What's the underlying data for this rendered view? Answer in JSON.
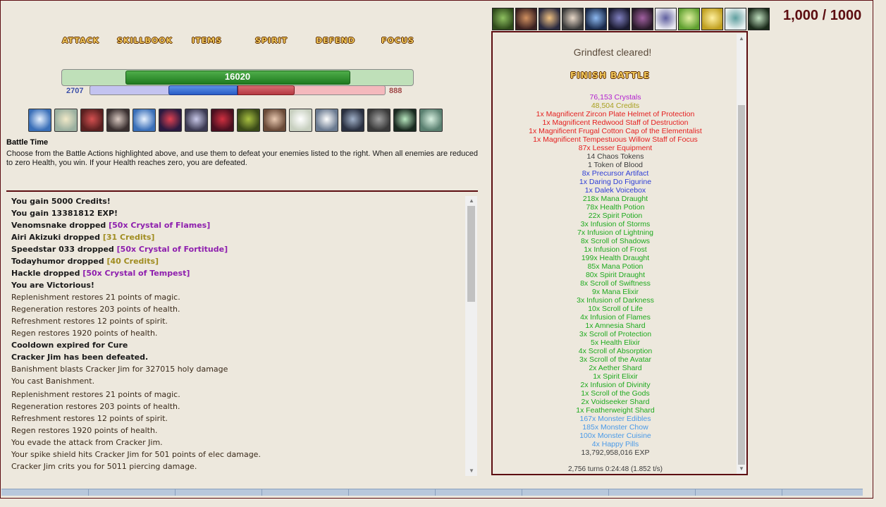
{
  "battle_actions": {
    "attack": "ATTACK",
    "skillbook": "SKILLBOOK",
    "items": "ITEMS",
    "spirit": "SPIRIT",
    "defend": "DEFEND",
    "focus": "FOCUS"
  },
  "player": {
    "health": "16020",
    "health_fill": 0.64,
    "magic": "2707",
    "magic_fill": 0.47,
    "spirit": "888",
    "spirit_fill": 0.39
  },
  "skill_icons": [
    "shield-face-icon",
    "blade-icon",
    "demon-icon",
    "skull-icon",
    "frost-face-icon",
    "fire-icon",
    "wraith-icon",
    "blood-mage-icon",
    "nature-icon",
    "claw-icon",
    "mist-icon",
    "ghost-icon",
    "hooded-icon",
    "monk-icon",
    "cross-icon",
    "wing-icon"
  ],
  "battle_time": {
    "title": "Battle Time",
    "description": "Choose from the Battle Actions highlighted above, and use them to defeat your enemies listed to the right. When all enemies are reduced to zero Health, you win. If your Health reaches zero, you are defeated."
  },
  "log": [
    {
      "text": "You gain 5000 Credits!",
      "bold": true
    },
    {
      "text": "You gain 13381812 EXP!",
      "bold": true
    },
    {
      "prefix": "Venomsnake dropped ",
      "item": "[50x Crystal of Flames]",
      "color": "purple",
      "bold": true
    },
    {
      "prefix": "Airi Akizuki dropped ",
      "item": "[31 Credits]",
      "color": "gold",
      "bold": true
    },
    {
      "prefix": "Speedstar 033 dropped ",
      "item": "[50x Crystal of Fortitude]",
      "color": "purple",
      "bold": true
    },
    {
      "prefix": "Todayhumor dropped ",
      "item": "[40 Credits]",
      "color": "gold",
      "bold": true
    },
    {
      "prefix": "Hackle dropped ",
      "item": "[50x Crystal of Tempest]",
      "color": "purple",
      "bold": true
    },
    {
      "text": "You are Victorious!",
      "bold": true
    },
    {
      "text": "Replenishment restores 21 points of magic.",
      "bold": false
    },
    {
      "text": "Regeneration restores 203 points of health.",
      "bold": false
    },
    {
      "text": "Refreshment restores 12 points of spirit.",
      "bold": false
    },
    {
      "text": "Regen restores 1920 points of health.",
      "bold": false
    },
    {
      "text": "Cooldown expired for Cure",
      "bold": true
    },
    {
      "text": "Cracker Jim has been defeated.",
      "bold": true
    },
    {
      "text": "Banishment blasts Cracker Jim for 327015 holy damage",
      "bold": false
    },
    {
      "text": "You cast Banishment.",
      "bold": false
    },
    {
      "text": "Replenishment restores 21 points of magic.",
      "bold": false
    },
    {
      "text": "Regeneration restores 203 points of health.",
      "bold": false
    },
    {
      "text": "Refreshment restores 12 points of spirit.",
      "bold": false
    },
    {
      "text": "Regen restores 1920 points of health.",
      "bold": false
    },
    {
      "text": "You evade the attack from Cracker Jim.",
      "bold": false
    },
    {
      "text": "Your spike shield hits Cracker Jim for 501 points of elec damage.",
      "bold": false
    },
    {
      "text": "Cracker Jim crits you for 5011 piercing damage.",
      "bold": false
    }
  ],
  "monster_icons": [
    "venom-icon",
    "horned-icon",
    "flame-burst-icon",
    "reaper-icon",
    "ice-witch-icon",
    "dark-knight-icon",
    "shadow-icon",
    "rune-icon",
    "emerald-icon",
    "sun-rune-icon",
    "frost-sprite-icon",
    "cross-rune-icon"
  ],
  "counter": "1,000 / 1000",
  "result": {
    "cleared": "Grindfest cleared!",
    "finish_button": "FINISH BATTLE",
    "drops": [
      {
        "text": "76,153 Crystals",
        "color": "purple"
      },
      {
        "text": "48,504 Credits",
        "color": "gold"
      },
      {
        "text": "1x Magnificent Zircon Plate Helmet of Protection",
        "color": "red"
      },
      {
        "text": "1x Magnificent Redwood Staff of Destruction",
        "color": "red"
      },
      {
        "text": "1x Magnificent Frugal Cotton Cap of the Elementalist",
        "color": "red"
      },
      {
        "text": "1x Magnificent Tempestuous Willow Staff of Focus",
        "color": "red"
      },
      {
        "text": "87x Lesser Equipment",
        "color": "red"
      },
      {
        "text": "14 Chaos Tokens",
        "color": "grey"
      },
      {
        "text": "1 Token of Blood",
        "color": "grey"
      },
      {
        "text": "8x Precursor Artifact",
        "color": "blue"
      },
      {
        "text": "1x Daring Do Figurine",
        "color": "blue"
      },
      {
        "text": "1x Dalek Voicebox",
        "color": "blue"
      },
      {
        "text": "218x Mana Draught",
        "color": "green"
      },
      {
        "text": "78x Health Potion",
        "color": "green"
      },
      {
        "text": "22x Spirit Potion",
        "color": "green"
      },
      {
        "text": "3x Infusion of Storms",
        "color": "green"
      },
      {
        "text": "7x Infusion of Lightning",
        "color": "green"
      },
      {
        "text": "8x Scroll of Shadows",
        "color": "green"
      },
      {
        "text": "1x Infusion of Frost",
        "color": "green"
      },
      {
        "text": "199x Health Draught",
        "color": "green"
      },
      {
        "text": "85x Mana Potion",
        "color": "green"
      },
      {
        "text": "80x Spirit Draught",
        "color": "green"
      },
      {
        "text": "8x Scroll of Swiftness",
        "color": "green"
      },
      {
        "text": "9x Mana Elixir",
        "color": "green"
      },
      {
        "text": "3x Infusion of Darkness",
        "color": "green"
      },
      {
        "text": "10x Scroll of Life",
        "color": "green"
      },
      {
        "text": "4x Infusion of Flames",
        "color": "green"
      },
      {
        "text": "1x Amnesia Shard",
        "color": "green"
      },
      {
        "text": "3x Scroll of Protection",
        "color": "green"
      },
      {
        "text": "5x Health Elixir",
        "color": "green"
      },
      {
        "text": "4x Scroll of Absorption",
        "color": "green"
      },
      {
        "text": "3x Scroll of the Avatar",
        "color": "green"
      },
      {
        "text": "2x Aether Shard",
        "color": "green"
      },
      {
        "text": "1x Spirit Elixir",
        "color": "green"
      },
      {
        "text": "2x Infusion of Divinity",
        "color": "green"
      },
      {
        "text": "1x Scroll of the Gods",
        "color": "green"
      },
      {
        "text": "2x Voidseeker Shard",
        "color": "green"
      },
      {
        "text": "1x Featherweight Shard",
        "color": "green"
      },
      {
        "text": "167x Monster Edibles",
        "color": "lblue"
      },
      {
        "text": "185x Monster Chow",
        "color": "lblue"
      },
      {
        "text": "100x Monster Cuisine",
        "color": "lblue"
      },
      {
        "text": "4x Happy Pills",
        "color": "lblue"
      },
      {
        "text": "13,792,958,016 EXP",
        "color": "grey"
      }
    ],
    "turns": "2,756 turns 0:24:48 (1.852 t/s)"
  },
  "colors": {
    "accent": "#5c0d11",
    "background": "#ede8dd",
    "health": "#2f8e2b",
    "magic": "#3a6fd4",
    "spirit": "#c24a52"
  }
}
